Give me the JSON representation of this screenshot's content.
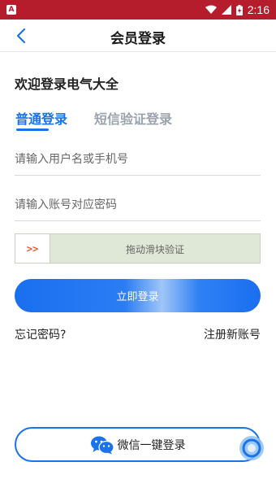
{
  "statusbar": {
    "app_badge": "A",
    "time": "2:16"
  },
  "nav": {
    "title": "会员登录"
  },
  "welcome": "欢迎登录电气大全",
  "tabs": {
    "normal": "普通登录",
    "sms": "短信验证登录"
  },
  "form": {
    "username_placeholder": "请输入用户名或手机号",
    "password_placeholder": "请输入账号对应密码",
    "slider_handle": ">>",
    "slider_text": "拖动滑块验证",
    "login_label": "立即登录",
    "forgot_label": "忘记密码?",
    "register_label": "注册新账号"
  },
  "wechat": {
    "label": "微信一键登录"
  },
  "colors": {
    "statusbar": "#b51c2c",
    "accent": "#1a73e8"
  }
}
